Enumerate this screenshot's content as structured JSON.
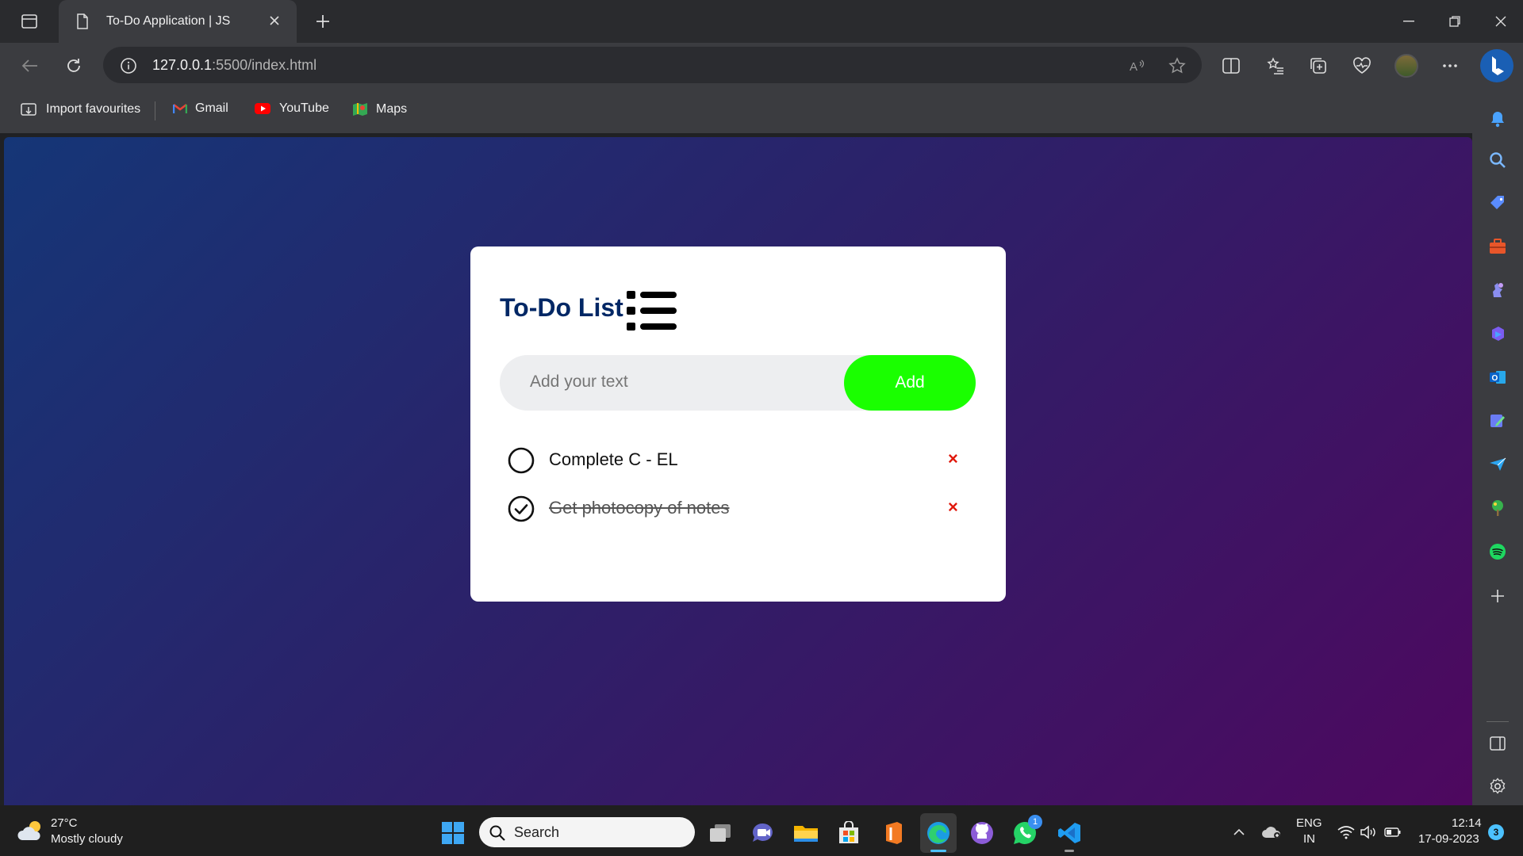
{
  "browser": {
    "tab_title": "To-Do Application | JS",
    "url_host": "127.0.0.1",
    "url_rest": ":5500/index.html",
    "bookmarks": [
      {
        "label": "Import favourites",
        "icon": "import-favourites-icon"
      },
      {
        "label": "Gmail",
        "icon": "gmail-icon"
      },
      {
        "label": "YouTube",
        "icon": "youtube-icon"
      },
      {
        "label": "Maps",
        "icon": "maps-icon"
      }
    ]
  },
  "app": {
    "title": "To-Do List",
    "input_placeholder": "Add your text",
    "add_label": "Add",
    "tasks": [
      {
        "text": "Complete C - EL",
        "done": false
      },
      {
        "text": "Get photocopy of notes",
        "done": true
      }
    ],
    "delete_glyph": "×"
  },
  "taskbar": {
    "weather_temp": "27°C",
    "weather_desc": "Mostly cloudy",
    "search_label": "Search",
    "whatsapp_badge": "1",
    "lang": "ENG",
    "region": "IN",
    "time": "12:14",
    "date": "17-09-2023",
    "notification_count": "3"
  },
  "colors": {
    "accent_green": "#1aff00",
    "title_navy": "#002765",
    "delete_red": "#e0180c",
    "gradient_start": "#153677",
    "gradient_end": "#4e085f"
  }
}
